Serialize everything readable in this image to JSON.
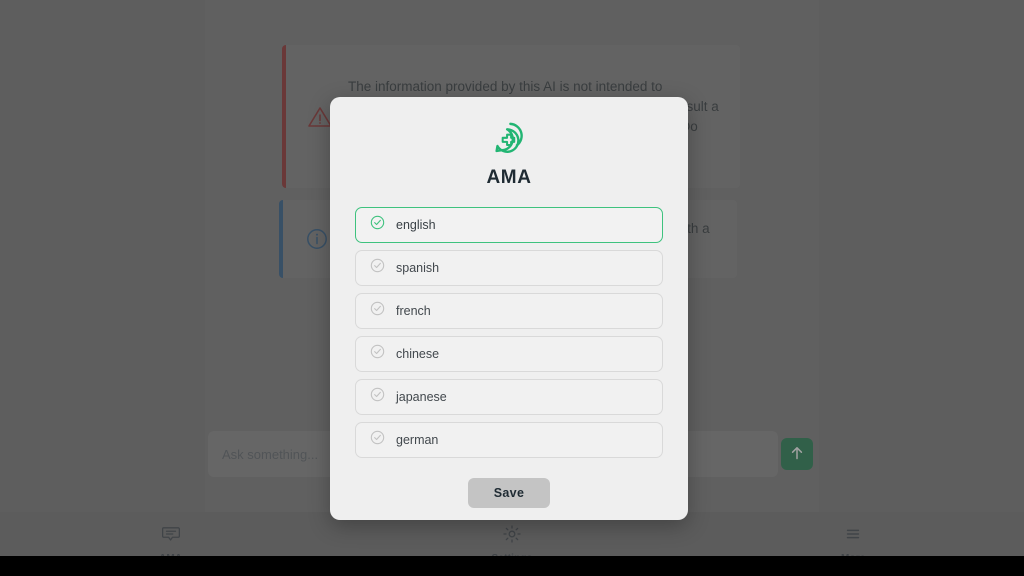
{
  "app": {
    "background_panel_color": "#7a7a7a",
    "overlay_color": "rgba(70,70,70,0.50)"
  },
  "banners": {
    "warning": {
      "icon": "warning-triangle-icon",
      "accent_color": "#8e2b2b",
      "text": "The information provided by this AI is not intended to diagnose, treat, cure or prevent any disease. Always consult a doctor if you have questions about a medical condition. Do not delay seeking advice based on this content."
    },
    "info": {
      "icon": "info-circle-icon",
      "accent_color": "#2a5a86",
      "text": "Responses may be inaccurate. Verify important details with a licensed professional."
    }
  },
  "composer": {
    "placeholder": "Ask something...",
    "value": "",
    "send_icon": "arrow-up-icon",
    "send_color": "#1d7a4c"
  },
  "bottom_nav": {
    "items": [
      {
        "label": "AMA",
        "icon": "chat-bubble-icon"
      },
      {
        "label": "Settings",
        "icon": "gear-icon"
      },
      {
        "label": "More",
        "icon": "hamburger-menu-icon"
      }
    ]
  },
  "modal": {
    "logo_icon": "ama-medical-chat-logo-icon",
    "logo_color": "#22b573",
    "title": "AMA",
    "selected_color": "#3ec27e",
    "languages": [
      {
        "label": "english",
        "selected": true
      },
      {
        "label": "spanish",
        "selected": false
      },
      {
        "label": "french",
        "selected": false
      },
      {
        "label": "chinese",
        "selected": false
      },
      {
        "label": "japanese",
        "selected": false
      },
      {
        "label": "german",
        "selected": false
      }
    ],
    "save_label": "Save"
  }
}
